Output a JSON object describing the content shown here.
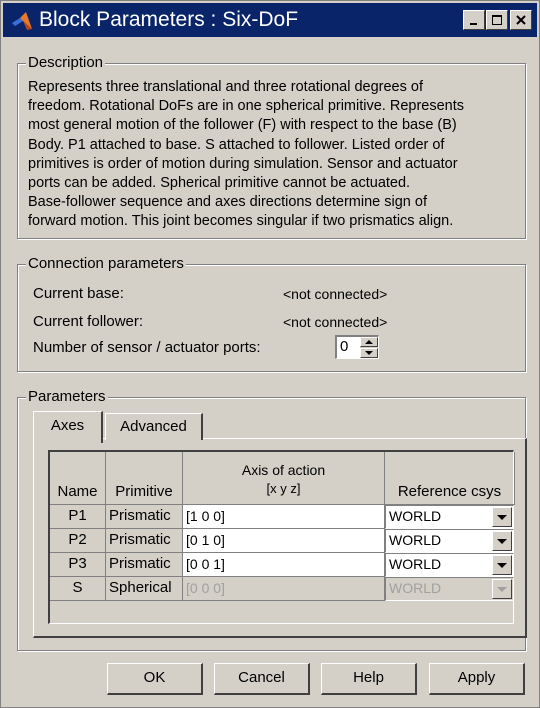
{
  "window": {
    "title": "Block Parameters : Six-DoF"
  },
  "description": {
    "legend": "Description",
    "lines": [
      "Represents three translational and three rotational degrees of",
      "freedom. Rotational DoFs are in one spherical primitive. Represents",
      "most general motion of the follower (F) with respect to the base (B)",
      "Body. P1 attached to base. S attached to follower. Listed order of",
      "primitives is order of motion during simulation. Sensor and actuator",
      "ports can be added. Spherical primitive cannot be actuated.",
      "Base-follower sequence and axes directions determine sign of",
      "forward motion. This joint becomes singular if two prismatics align."
    ]
  },
  "connection": {
    "legend": "Connection parameters",
    "base_label": "Current base:",
    "base_value": "<not connected>",
    "follower_label": "Current follower:",
    "follower_value": "<not connected>",
    "ports_label": "Number of sensor / actuator ports:",
    "ports_value": "0"
  },
  "parameters": {
    "legend": "Parameters",
    "tabs": [
      {
        "label": "Axes"
      },
      {
        "label": "Advanced"
      }
    ],
    "columns": {
      "name": "Name",
      "primitive": "Primitive",
      "axis": "Axis of action",
      "axis_sub": "[x y z]",
      "ref": "Reference csys"
    },
    "rows": [
      {
        "name": "P1",
        "primitive": "Prismatic",
        "axis": "[1 0 0]",
        "ref": "WORLD",
        "enabled": true
      },
      {
        "name": "P2",
        "primitive": "Prismatic",
        "axis": "[0 1 0]",
        "ref": "WORLD",
        "enabled": true
      },
      {
        "name": "P3",
        "primitive": "Prismatic",
        "axis": "[0 0 1]",
        "ref": "WORLD",
        "enabled": true
      },
      {
        "name": "S",
        "primitive": "Spherical",
        "axis": "[0 0 0]",
        "ref": "WORLD",
        "enabled": false
      }
    ]
  },
  "buttons": {
    "ok": "OK",
    "cancel": "Cancel",
    "help": "Help",
    "apply": "Apply"
  },
  "colors": {
    "titlebar": "#0a246a",
    "face": "#d4d0c8",
    "disabled": "#a0a0a0"
  }
}
